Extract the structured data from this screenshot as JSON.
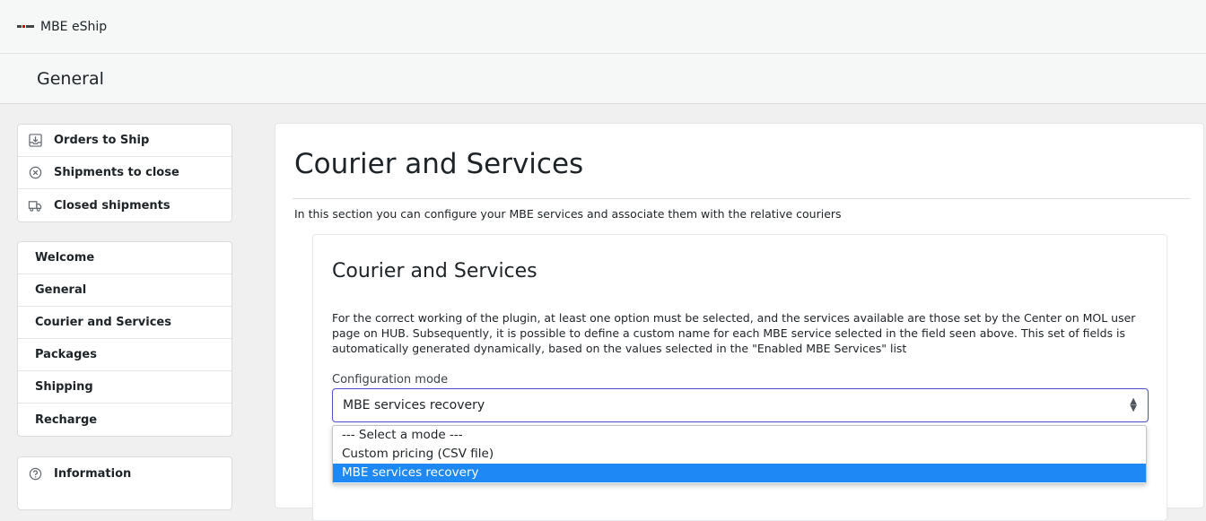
{
  "app": {
    "title": "MBE eShip"
  },
  "page": {
    "title": "General"
  },
  "sidebar": {
    "shipping_items": [
      {
        "label": "Orders to Ship",
        "icon": "inbox-download-icon"
      },
      {
        "label": "Shipments to close",
        "icon": "circle-x-icon"
      },
      {
        "label": "Closed shipments",
        "icon": "truck-icon"
      }
    ],
    "config_items": [
      {
        "label": "Welcome"
      },
      {
        "label": "General"
      },
      {
        "label": "Courier and Services"
      },
      {
        "label": "Packages"
      },
      {
        "label": "Shipping"
      },
      {
        "label": "Recharge"
      }
    ],
    "info_items": [
      {
        "label": "Information",
        "icon": "question-circle-icon"
      }
    ]
  },
  "main": {
    "heading": "Courier and Services",
    "intro": "In this section you can configure your MBE services and associate them with the relative couriers",
    "section": {
      "heading": "Courier and Services",
      "description": "For the correct working of the plugin, at least one option must be selected, and the services available are those set by the Center on MOL user page on HUB. Subsequently, it is possible to define a custom name for each MBE service selected in the field seen above. This set of fields is automatically generated dynamically, based on the values selected in the \"Enabled MBE Services\" list",
      "config_mode": {
        "label": "Configuration mode",
        "value": "MBE services recovery",
        "options": [
          "--- Select a mode ---",
          "Custom pricing (CSV file)",
          "MBE services recovery"
        ],
        "selected_index": 2
      }
    }
  },
  "colors": {
    "accent": "#4a53c5",
    "selected_option": "#1e88f5"
  }
}
